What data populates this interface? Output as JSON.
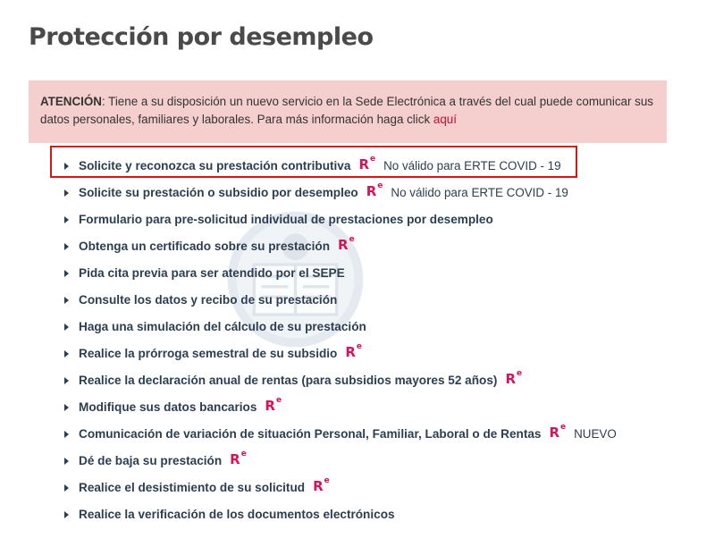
{
  "page": {
    "title": "Protección por desempleo"
  },
  "notice": {
    "strong": "ATENCIÓN",
    "text": ": Tiene a su disposición un nuevo servicio en la Sede Electrónica a través del cual puede comunicar sus datos personales, familiares y laborales. Para más información haga click ",
    "link": "aquí"
  },
  "icons": {
    "bullet": "triangle-right-icon",
    "sede": "sede-electronica-re-icon"
  },
  "re_icon": {
    "letter": "R",
    "sup": "e"
  },
  "colors": {
    "notice_bg": "#f5cece",
    "link": "#c8102e",
    "re_icon": "#d4145a",
    "highlight": "#dd1414",
    "text": "#2c3e50"
  },
  "items": [
    {
      "label": "Solicite y reconozca su prestación contributiva",
      "re": true,
      "note": "No válido para ERTE COVID - 19"
    },
    {
      "label": "Solicite su prestación o subsidio por desempleo",
      "re": true,
      "note": "No válido para ERTE COVID - 19"
    },
    {
      "label": "Formulario para pre-solicitud individual de prestaciones por desempleo",
      "re": false,
      "note": ""
    },
    {
      "label": "Obtenga un certificado sobre su prestación",
      "re": true,
      "note": ""
    },
    {
      "label": "Pida cita previa para ser atendido por el SEPE",
      "re": false,
      "note": ""
    },
    {
      "label": "Consulte los datos y recibo de su prestación",
      "re": false,
      "note": ""
    },
    {
      "label": "Haga una simulación del cálculo de su prestación",
      "re": false,
      "note": ""
    },
    {
      "label": "Realice la prórroga semestral de su subsidio",
      "re": true,
      "note": ""
    },
    {
      "label": "Realice la declaración anual de rentas (para subsidios mayores 52 años)",
      "re": true,
      "note": ""
    },
    {
      "label": "Modifique sus datos bancarios",
      "re": true,
      "note": ""
    },
    {
      "label": "Comunicación de variación de situación Personal, Familiar, Laboral o de Rentas",
      "re": true,
      "note": "NUEVO"
    },
    {
      "label": "Dé de baja su prestación",
      "re": true,
      "note": ""
    },
    {
      "label": "Realice el desistimiento de su solicitud",
      "re": true,
      "note": ""
    },
    {
      "label": "Realice la verificación de los documentos electrónicos",
      "re": false,
      "note": ""
    }
  ]
}
